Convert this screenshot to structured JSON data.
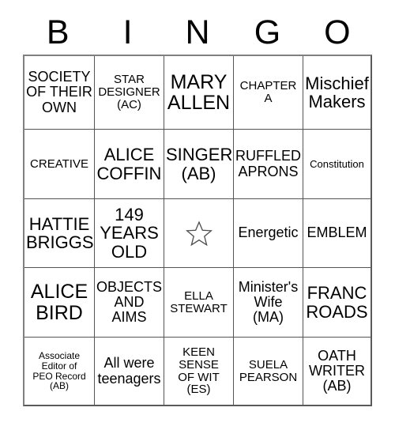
{
  "card": {
    "title": "Bingo Card",
    "header_letters": [
      "B",
      "I",
      "N",
      "G",
      "O"
    ],
    "free_space_icon": "star-outline-icon",
    "colors": {
      "text": "#000000",
      "grid_line": "#555555",
      "grid_border": "#808080",
      "background": "#ffffff",
      "star_outline": "#4a4a4a"
    },
    "rows": [
      [
        {
          "text": "SOCIETY\nOF THEIR\nOWN",
          "size": "md"
        },
        {
          "text": "STAR\nDESIGNER\n(AC)",
          "size": "sm"
        },
        {
          "text": "MARY\nALLEN",
          "size": "xxl"
        },
        {
          "text": "CHAPTER\nA",
          "size": "sm"
        },
        {
          "text": "Mischief\nMakers",
          "size": "xl"
        }
      ],
      [
        {
          "text": "CREATIVE",
          "size": "sm"
        },
        {
          "text": "ALICE\nCOFFIN",
          "size": "xl"
        },
        {
          "text": "SINGER\n(AB)",
          "size": "xl"
        },
        {
          "text": "RUFFLED\nAPRONS",
          "size": "md"
        },
        {
          "text": "Constitution",
          "size": "xs"
        }
      ],
      [
        {
          "text": "HATTIE\nBRIGGS",
          "size": "xl"
        },
        {
          "text": "149\nYEARS\nOLD",
          "size": "xl"
        },
        {
          "text": "",
          "size": "md",
          "free": true
        },
        {
          "text": "Energetic",
          "size": "md"
        },
        {
          "text": "EMBLEM",
          "size": "md"
        }
      ],
      [
        {
          "text": "ALICE\nBIRD",
          "size": "xxl"
        },
        {
          "text": "OBJECTS\nAND\nAIMS",
          "size": "md"
        },
        {
          "text": "ELLA\nSTEWART",
          "size": "sm"
        },
        {
          "text": "Minister's\nWife\n(MA)",
          "size": "md"
        },
        {
          "text": "FRANC\nROADS",
          "size": "xl"
        }
      ],
      [
        {
          "text": "Associate\nEditor of\nPEO Record\n(AB)",
          "size": "xxs"
        },
        {
          "text": "All were\nteenagers",
          "size": "md"
        },
        {
          "text": "KEEN\nSENSE\nOF WIT\n(ES)",
          "size": "sm"
        },
        {
          "text": "SUELA\nPEARSON",
          "size": "sm"
        },
        {
          "text": "OATH\nWRITER\n(AB)",
          "size": "md"
        }
      ]
    ]
  }
}
